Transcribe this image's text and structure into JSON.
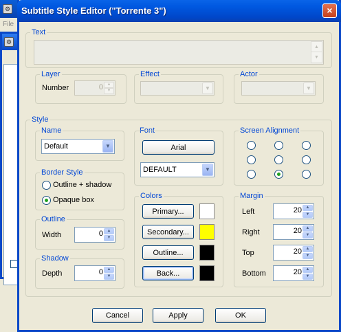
{
  "background_app": {
    "menu_label": "File"
  },
  "dialog": {
    "title": "Subtitle Style Editor (\"Torrente 3\")",
    "close_glyph": "×",
    "text_group": {
      "label": "Text",
      "value": ""
    },
    "layer_group": {
      "label": "Layer",
      "number_label": "Number",
      "number_value": "0"
    },
    "effect_group": {
      "label": "Effect",
      "value": ""
    },
    "actor_group": {
      "label": "Actor",
      "value": ""
    },
    "style_group": {
      "label": "Style",
      "name_group": {
        "label": "Name",
        "value": "Default"
      },
      "font_group": {
        "label": "Font",
        "font_button": "Arial",
        "charset_value": "DEFAULT"
      },
      "alignment_group": {
        "label": "Screen Alignment",
        "selected_index": 7
      },
      "border_group": {
        "label": "Border Style",
        "options": [
          "Outline + shadow",
          "Opaque box"
        ],
        "selected": "Opaque box"
      },
      "colors_group": {
        "label": "Colors",
        "buttons": [
          {
            "label": "Primary...",
            "color": "#ffffff"
          },
          {
            "label": "Secondary...",
            "color": "#ffff00"
          },
          {
            "label": "Outline...",
            "color": "#000000"
          },
          {
            "label": "Back...",
            "color": "#000000"
          }
        ]
      },
      "margin_group": {
        "label": "Margin",
        "fields": [
          {
            "label": "Left",
            "value": "20"
          },
          {
            "label": "Right",
            "value": "20"
          },
          {
            "label": "Top",
            "value": "20"
          },
          {
            "label": "Bottom",
            "value": "20"
          }
        ]
      },
      "outline_group": {
        "label": "Outline",
        "field_label": "Width",
        "value": "0"
      },
      "shadow_group": {
        "label": "Shadow",
        "field_label": "Depth",
        "value": "0"
      }
    },
    "buttons": {
      "cancel": "Cancel",
      "apply": "Apply",
      "ok": "OK"
    }
  }
}
